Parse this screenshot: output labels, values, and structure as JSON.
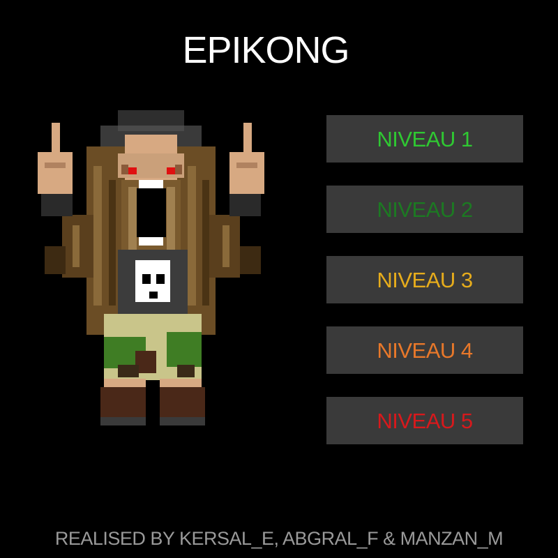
{
  "title": "EPIKONG",
  "character": {
    "icon": "pixel-rocker-character",
    "colors": {
      "hair": "#6b4d25",
      "skin": "#d7a982",
      "eyes": "#e01010",
      "shirt": "#3c3c3c",
      "skull": "#ffffff",
      "camo_light": "#c9c58a",
      "camo_green": "#3f7d24",
      "boots": "#4a2818"
    }
  },
  "levels": [
    {
      "label": "NIVEAU 1",
      "color": "#2fc832"
    },
    {
      "label": "NIVEAU 2",
      "color": "#1c7a22"
    },
    {
      "label": "NIVEAU 3",
      "color": "#e6ac1c"
    },
    {
      "label": "NIVEAU 4",
      "color": "#e8782a"
    },
    {
      "label": "NIVEAU 5",
      "color": "#d7191c"
    }
  ],
  "footer": "REALISED BY  KERSAL_E, ABGRAL_F & MANZAN_M"
}
